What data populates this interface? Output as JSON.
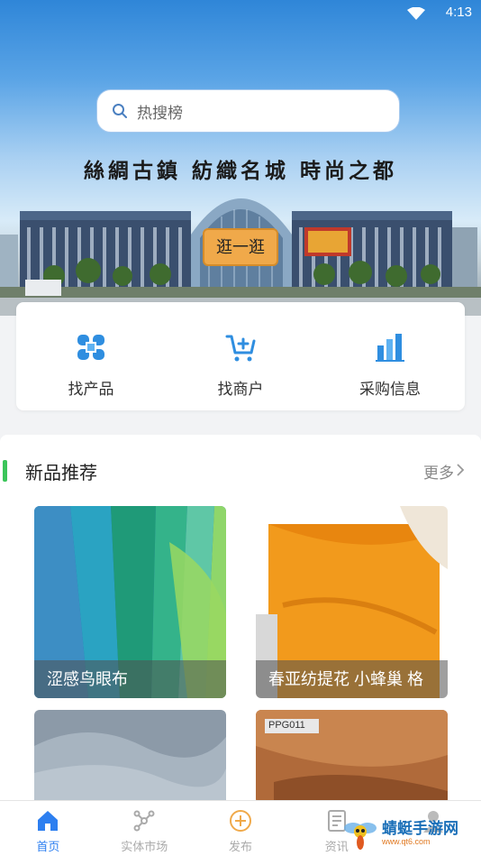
{
  "status": {
    "time": "4:13"
  },
  "search": {
    "placeholder": "热搜榜"
  },
  "banner": {
    "slogan": "絲綢古鎮  紡織名城  時尚之都",
    "button": "逛一逛"
  },
  "quick_nav": [
    {
      "label": "找产品",
      "icon": "grid-knot-icon"
    },
    {
      "label": "找商户",
      "icon": "cart-add-icon"
    },
    {
      "label": "采购信息",
      "icon": "bar-chart-icon"
    }
  ],
  "new_products": {
    "title": "新品推荐",
    "more": "更多",
    "items": [
      {
        "caption": "涩感鸟眼布"
      },
      {
        "caption": "春亚纺提花 小蜂巢 格"
      },
      {
        "caption": ""
      },
      {
        "caption": "",
        "tag": "PPG011"
      }
    ]
  },
  "tabbar": [
    {
      "label": "首页",
      "active": true,
      "icon": "home-icon"
    },
    {
      "label": "实体市场",
      "active": false,
      "icon": "network-icon"
    },
    {
      "label": "发布",
      "active": false,
      "icon": "plus-circle-icon"
    },
    {
      "label": "资讯",
      "active": false,
      "icon": "document-icon"
    },
    {
      "label": "",
      "active": false,
      "icon": "user-icon"
    }
  ],
  "watermark": {
    "title": "蜻蜓手游网",
    "url": "www.qt6.com"
  },
  "colors": {
    "accent": "#2d7ff0",
    "section_bar": "#3bc55a",
    "banner_button": "#f0a94a"
  }
}
